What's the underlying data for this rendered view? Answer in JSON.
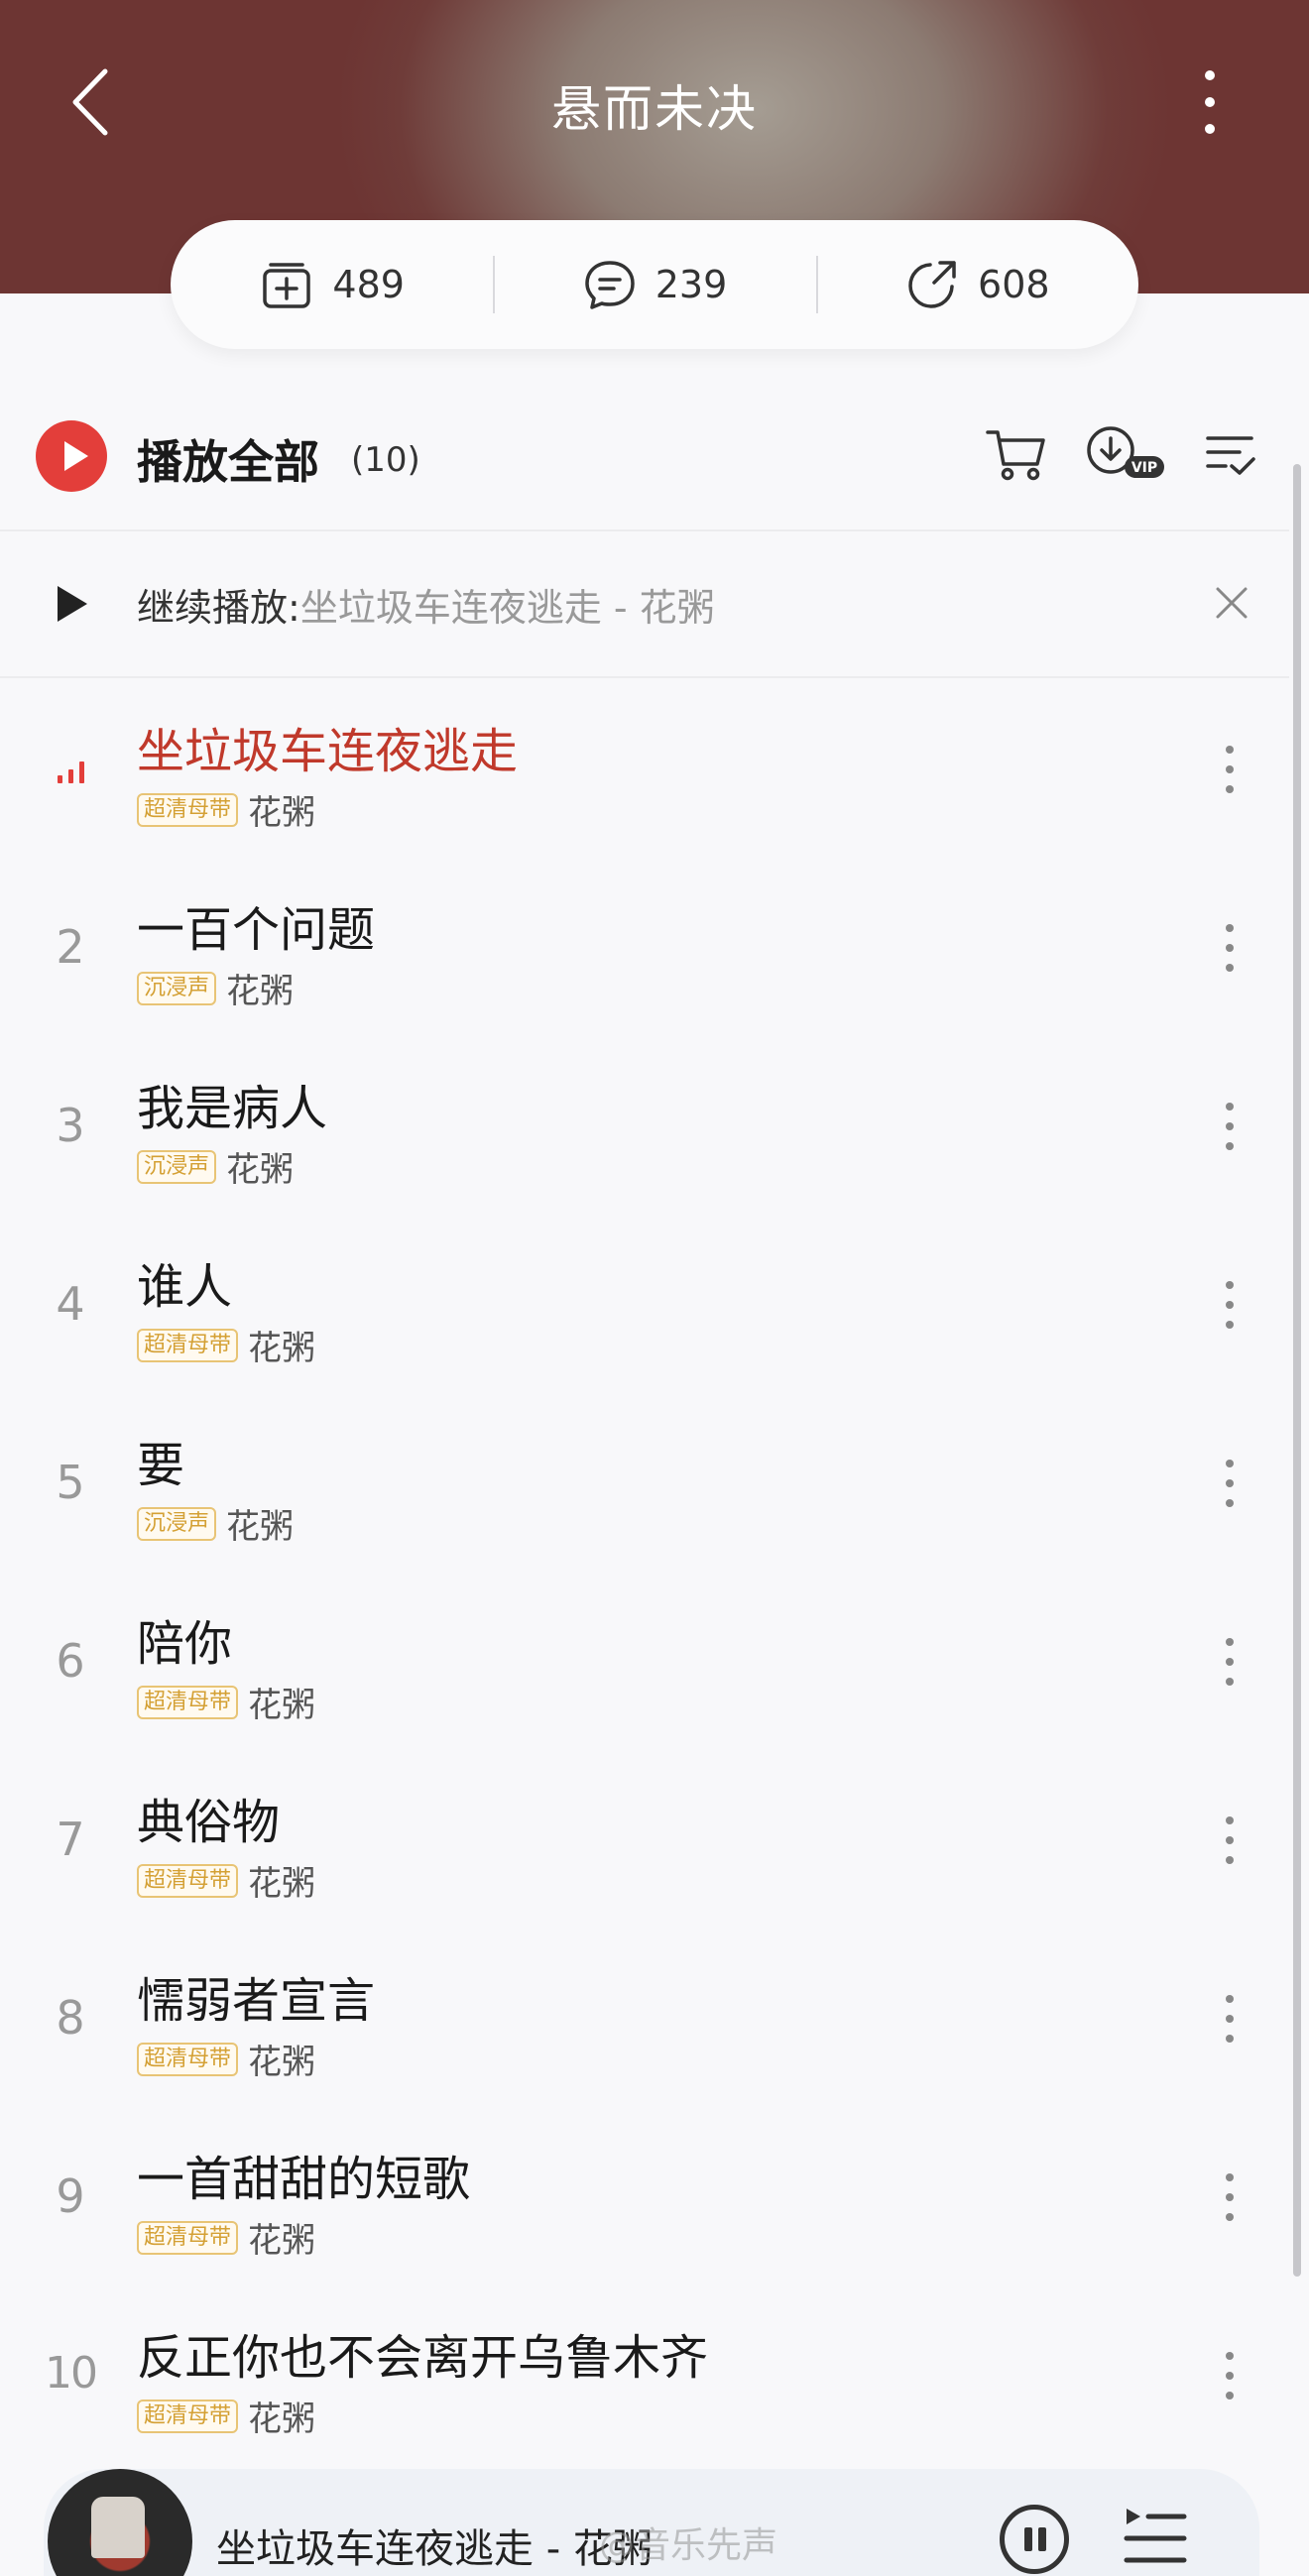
{
  "header": {
    "title": "悬而未决"
  },
  "stats": {
    "collect": "489",
    "comments": "239",
    "share": "608"
  },
  "play_all": {
    "label": "播放全部",
    "count": "(10)"
  },
  "resume": {
    "label": "继续播放:",
    "song": "坐垃圾车连夜逃走 - 花粥"
  },
  "songs": [
    {
      "rank": "",
      "title": "坐垃圾车连夜逃走",
      "tag": "超清母带",
      "artist": "花粥",
      "playing": true
    },
    {
      "rank": "2",
      "title": "一百个问题",
      "tag": "沉浸声",
      "artist": "花粥"
    },
    {
      "rank": "3",
      "title": "我是病人",
      "tag": "沉浸声",
      "artist": "花粥"
    },
    {
      "rank": "4",
      "title": "谁人",
      "tag": "超清母带",
      "artist": "花粥"
    },
    {
      "rank": "5",
      "title": "要",
      "tag": "沉浸声",
      "artist": "花粥"
    },
    {
      "rank": "6",
      "title": "陪你",
      "tag": "超清母带",
      "artist": "花粥"
    },
    {
      "rank": "7",
      "title": "典俗物",
      "tag": "超清母带",
      "artist": "花粥"
    },
    {
      "rank": "8",
      "title": "懦弱者宣言",
      "tag": "超清母带",
      "artist": "花粥"
    },
    {
      "rank": "9",
      "title": "一首甜甜的短歌",
      "tag": "超清母带",
      "artist": "花粥"
    },
    {
      "rank": "10",
      "title": "反正你也不会离开乌鲁木齐",
      "tag": "超清母带",
      "artist": "花粥"
    }
  ],
  "player": {
    "song": "坐垃圾车连夜逃走 - 花粥",
    "watermark": "@音乐先声"
  },
  "colors": {
    "accent": "#e33e3a",
    "active_title": "#c0392b",
    "tag": "#d4a034"
  },
  "icons": {
    "back": "chevron-left-icon",
    "more": "more-vertical-icon",
    "collect": "add-to-collection-icon",
    "comment": "comment-icon",
    "share": "share-icon",
    "cart": "cart-icon",
    "download": "download-vip-icon",
    "multi_select": "multi-select-icon",
    "close": "close-icon",
    "pause": "pause-icon",
    "queue": "playlist-queue-icon"
  }
}
